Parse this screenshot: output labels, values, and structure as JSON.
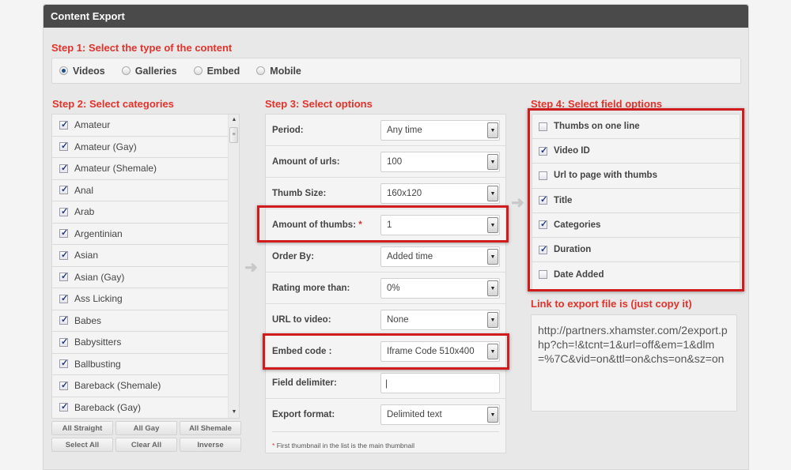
{
  "header": {
    "title": "Content Export"
  },
  "step1": {
    "title": "Step 1: Select the type of the content",
    "options": [
      {
        "label": "Videos",
        "selected": true
      },
      {
        "label": "Galleries",
        "selected": false
      },
      {
        "label": "Embed",
        "selected": false
      },
      {
        "label": "Mobile",
        "selected": false
      }
    ]
  },
  "step2": {
    "title": "Step 2: Select categories",
    "categories": [
      {
        "label": "Amateur",
        "checked": true
      },
      {
        "label": "Amateur (Gay)",
        "checked": true
      },
      {
        "label": "Amateur (Shemale)",
        "checked": true
      },
      {
        "label": "Anal",
        "checked": true
      },
      {
        "label": "Arab",
        "checked": true
      },
      {
        "label": "Argentinian",
        "checked": true
      },
      {
        "label": "Asian",
        "checked": true
      },
      {
        "label": "Asian (Gay)",
        "checked": true
      },
      {
        "label": "Ass Licking",
        "checked": true
      },
      {
        "label": "Babes",
        "checked": true
      },
      {
        "label": "Babysitters",
        "checked": true
      },
      {
        "label": "Ballbusting",
        "checked": true
      },
      {
        "label": "Bareback (Shemale)",
        "checked": true
      },
      {
        "label": "Bareback (Gay)",
        "checked": true
      }
    ],
    "buttons": {
      "all_straight": "All Straight",
      "all_gay": "All Gay",
      "all_shemale": "All Shemale",
      "select_all": "Select All",
      "clear_all": "Clear All",
      "inverse": "Inverse"
    }
  },
  "step3": {
    "title": "Step 3: Select options",
    "options": {
      "period": {
        "label": "Period:",
        "value": "Any time"
      },
      "amount_urls": {
        "label": "Amount of urls:",
        "value": "100"
      },
      "thumb_size": {
        "label": "Thumb Size:",
        "value": "160x120"
      },
      "amount_thumbs": {
        "label": "Amount of thumbs:",
        "required_mark": "*",
        "value": "1"
      },
      "order_by": {
        "label": "Order By:",
        "value": "Added time"
      },
      "rating": {
        "label": "Rating more than:",
        "value": "0%"
      },
      "url_video": {
        "label": "URL to video:",
        "value": "None"
      },
      "embed_code": {
        "label": "Embed code :",
        "value": "Iframe Code 510x400"
      },
      "field_delimiter": {
        "label": "Field delimiter:",
        "value": "|"
      },
      "export_format": {
        "label": "Export format:",
        "value": "Delimited text"
      }
    },
    "note_mark": "*",
    "note": "First thumbnail in the list is the main thumbnail"
  },
  "step4": {
    "title": "Step 4: Select field options",
    "fields": [
      {
        "label": "Thumbs on one line",
        "checked": false
      },
      {
        "label": "Video ID",
        "checked": true
      },
      {
        "label": "Url to page with thumbs",
        "checked": false
      },
      {
        "label": "Title",
        "checked": true
      },
      {
        "label": "Categories",
        "checked": true
      },
      {
        "label": "Duration",
        "checked": true
      },
      {
        "label": "Date Added",
        "checked": false
      }
    ]
  },
  "export_link": {
    "title": "Link to export file is (just copy it)",
    "value": "http://partners.xhamster.com/2export.php?ch=!&tcnt=1&url=off&em=1&dlm=%7C&vid=on&ttl=on&chs=on&sz=on"
  },
  "colors": {
    "accent": "#e0332b",
    "highlight": "#d01c1c",
    "header_bg": "#4a4a4a"
  }
}
